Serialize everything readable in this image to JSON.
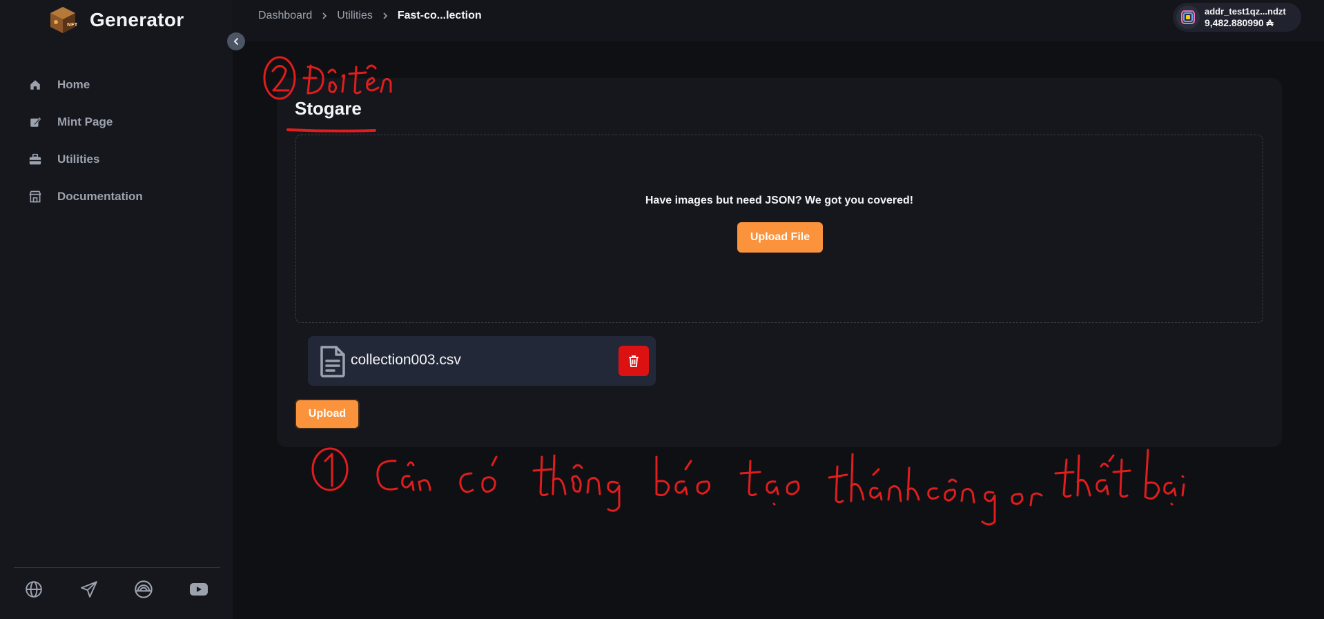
{
  "app": {
    "name": "Generator",
    "logo": "nft-cube-logo"
  },
  "sidebar": {
    "items": [
      {
        "label": "Home",
        "icon": "home-icon"
      },
      {
        "label": "Mint Page",
        "icon": "mint-icon"
      },
      {
        "label": "Utilities",
        "icon": "toolbox-icon"
      },
      {
        "label": "Documentation",
        "icon": "store-icon"
      }
    ],
    "social": [
      "globe-icon",
      "send-icon",
      "rainbow-icon",
      "youtube-icon"
    ]
  },
  "breadcrumb": [
    {
      "label": "Dashboard"
    },
    {
      "label": "Utilities"
    },
    {
      "label": "Fast-co...lection"
    }
  ],
  "wallet": {
    "address": "addr_test1qz...ndzt",
    "balance": "9,482.880990 ₳"
  },
  "main": {
    "title": "Stogare",
    "dropzone_text": "Have images but need JSON? We got you covered!",
    "upload_file_label": "Upload File",
    "files": [
      {
        "name": "collection003.csv"
      }
    ],
    "upload_label": "Upload"
  },
  "colors": {
    "accent": "#fb923c",
    "danger": "#dc1212",
    "annotation": "#e11d1d",
    "background": "#0f1014",
    "card": "#16171d"
  },
  "annotations": {
    "note_2": "② Đổi tên",
    "note_1": "① Cần có thông báo tạo thành công or thất bại"
  }
}
